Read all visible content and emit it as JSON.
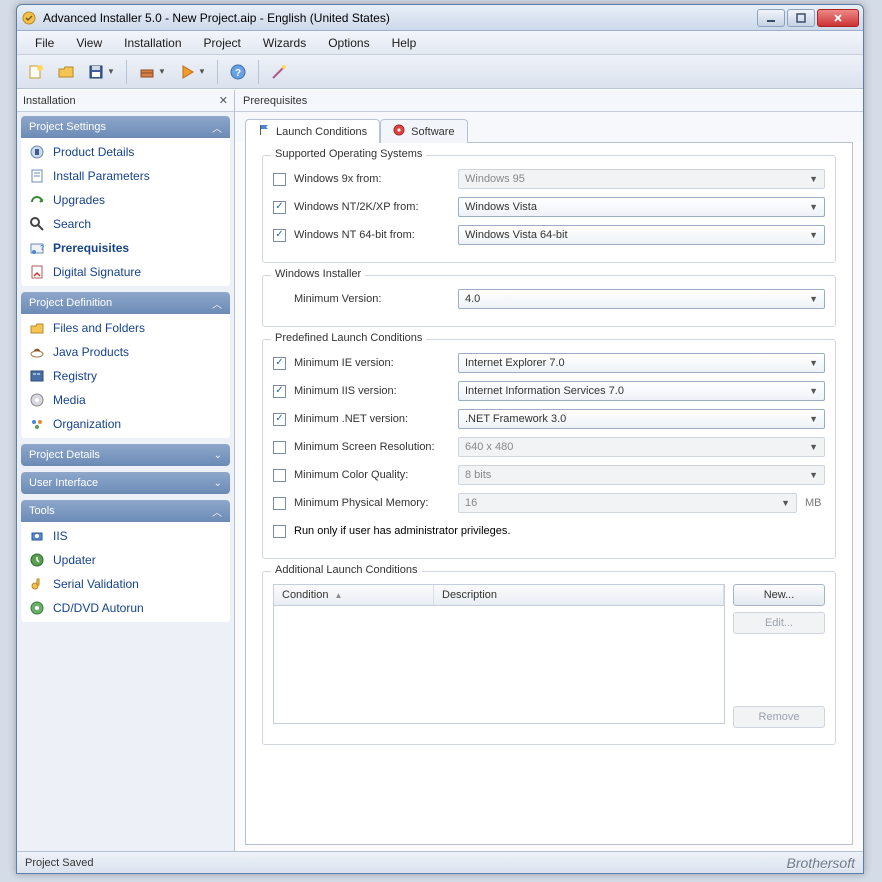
{
  "window": {
    "title": "Advanced Installer 5.0 - New Project.aip - English (United States)"
  },
  "menubar": [
    "File",
    "View",
    "Installation",
    "Project",
    "Wizards",
    "Options",
    "Help"
  ],
  "sidepane": {
    "title": "Installation"
  },
  "groups": [
    {
      "title": "Project Settings",
      "items": [
        {
          "label": "Product Details"
        },
        {
          "label": "Install Parameters"
        },
        {
          "label": "Upgrades"
        },
        {
          "label": "Search"
        },
        {
          "label": "Prerequisites",
          "selected": true
        },
        {
          "label": "Digital Signature"
        }
      ]
    },
    {
      "title": "Project Definition",
      "items": [
        {
          "label": "Files and Folders"
        },
        {
          "label": "Java Products"
        },
        {
          "label": "Registry"
        },
        {
          "label": "Media"
        },
        {
          "label": "Organization"
        }
      ]
    },
    {
      "title": "Project Details",
      "collapsed": true
    },
    {
      "title": "User Interface",
      "collapsed": true
    },
    {
      "title": "Tools",
      "items": [
        {
          "label": "IIS"
        },
        {
          "label": "Updater"
        },
        {
          "label": "Serial Validation"
        },
        {
          "label": "CD/DVD Autorun"
        }
      ]
    }
  ],
  "main": {
    "header": "Prerequisites"
  },
  "tabs": [
    {
      "label": "Launch Conditions",
      "active": true
    },
    {
      "label": "Software"
    }
  ],
  "supported_os": {
    "legend": "Supported Operating Systems",
    "rows": [
      {
        "checked": false,
        "label": "Windows 9x from:",
        "value": "Windows 95",
        "disabled": true
      },
      {
        "checked": true,
        "label": "Windows NT/2K/XP from:",
        "value": "Windows Vista"
      },
      {
        "checked": true,
        "label": "Windows NT 64-bit from:",
        "value": "Windows Vista 64-bit"
      }
    ]
  },
  "win_installer": {
    "legend": "Windows Installer",
    "label": "Minimum Version:",
    "value": "4.0"
  },
  "predefined": {
    "legend": "Predefined Launch Conditions",
    "rows": [
      {
        "checked": true,
        "label": "Minimum IE version:",
        "value": "Internet Explorer 7.0"
      },
      {
        "checked": true,
        "label": "Minimum IIS version:",
        "value": "Internet Information Services 7.0"
      },
      {
        "checked": true,
        "label": "Minimum .NET version:",
        "value": ".NET Framework 3.0"
      },
      {
        "checked": false,
        "label": "Minimum Screen Resolution:",
        "value": "640 x 480",
        "disabled": true
      },
      {
        "checked": false,
        "label": "Minimum Color Quality:",
        "value": "8 bits",
        "disabled": true
      },
      {
        "checked": false,
        "label": "Minimum Physical Memory:",
        "value": "16",
        "disabled": true,
        "unit": "MB"
      }
    ],
    "admin": {
      "checked": false,
      "label": "Run only if user has administrator privileges."
    }
  },
  "additional": {
    "legend": "Additional Launch Conditions",
    "cols": [
      "Condition",
      "Description"
    ],
    "buttons": {
      "new": "New...",
      "edit": "Edit...",
      "remove": "Remove"
    }
  },
  "status": "Project Saved",
  "branding": "Brothersoft"
}
